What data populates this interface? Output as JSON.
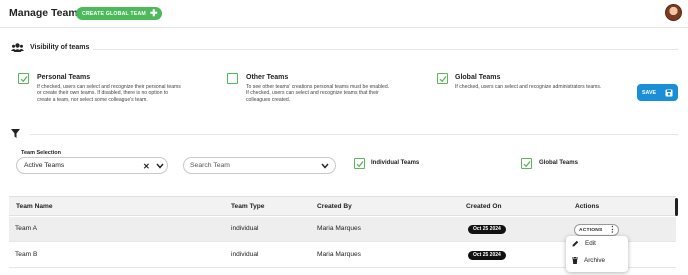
{
  "header": {
    "title": "Manage Teams",
    "create_button": "CREATE GLOBAL TEAM",
    "create_icon": "plus-icon",
    "avatar_icon": "user-avatar"
  },
  "visibility": {
    "title": "Visibility of teams",
    "icon": "users-icon",
    "options": [
      {
        "title": "Personal Teams",
        "checked": true,
        "desc_lines": [
          "If checked, users can select and recognize their personal teams",
          "or create their own teams. If disabled, there is no option to",
          "create a team, nor select some colleague's team."
        ]
      },
      {
        "title": "Other Teams",
        "checked": false,
        "desc_lines": [
          "To see other teams' creations personal teams must be enabled.",
          "If checked, users can select and recognize teams that their",
          "colleagues created."
        ]
      },
      {
        "title": "Global Teams",
        "checked": true,
        "desc_lines": [
          "If checked, users can select and recognize administrators teams."
        ]
      }
    ],
    "save_label": "SAVE",
    "save_icon": "save-icon"
  },
  "filters": {
    "icon": "filter-icon",
    "team_selection_label": "Team Selection",
    "team_selection_value": "Active Teams",
    "search_placeholder": "Search Team",
    "individual_label": "Individual Teams",
    "individual_checked": true,
    "global_label": "Global Teams",
    "global_checked": true
  },
  "table": {
    "headers": [
      "Team Name",
      "Team Type",
      "Created By",
      "Created On",
      "Actions"
    ],
    "rows": [
      {
        "name": "Team A",
        "type": "individual",
        "created_by": "Maria Marques",
        "created_on": "Oct 25 2024",
        "actions": "ACTIONS"
      },
      {
        "name": "Team B",
        "type": "individual",
        "created_by": "Maria Marques",
        "created_on": "Oct 25 2024"
      }
    ]
  },
  "menu": {
    "items": [
      {
        "label": "Edit",
        "icon": "pencil-icon"
      },
      {
        "label": "Archive",
        "icon": "trash-icon"
      }
    ]
  },
  "colors": {
    "accent_green": "#4cba5a",
    "save_blue": "#1a8fd8",
    "badge_dark": "#111111"
  }
}
